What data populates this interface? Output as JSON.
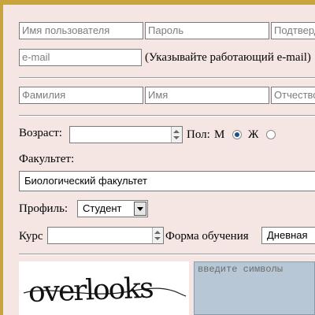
{
  "account": {
    "username_placeholder": "Имя пользователя",
    "password_placeholder": "Пароль",
    "confirm_placeholder": "Подтвердите",
    "email_placeholder": "e-mail",
    "email_hint": "(Указывайте работающий e-mail)"
  },
  "personal": {
    "lastname_placeholder": "Фамилия",
    "firstname_placeholder": "Имя",
    "patronymic_placeholder": "Отчество"
  },
  "details": {
    "age_label": "Возраст:",
    "age_value": "",
    "gender_label": "Пол:",
    "gender_m": "М",
    "gender_f": "Ж",
    "gender_selected": "М",
    "faculty_label": "Факультет:",
    "faculty_value": "Биологический факультет",
    "profile_label": "Профиль:",
    "profile_value": "Студент",
    "course_label": "Курс",
    "course_value": "",
    "study_form_label": "Форма обучения",
    "study_form_value": "Дневная"
  },
  "captcha": {
    "image_text": "overlooks",
    "input_placeholder": "введите символы"
  },
  "colors": {
    "background": "#f5e6e4",
    "border_accent": "#c9a33d",
    "captcha_field": "#b7c7d6"
  }
}
